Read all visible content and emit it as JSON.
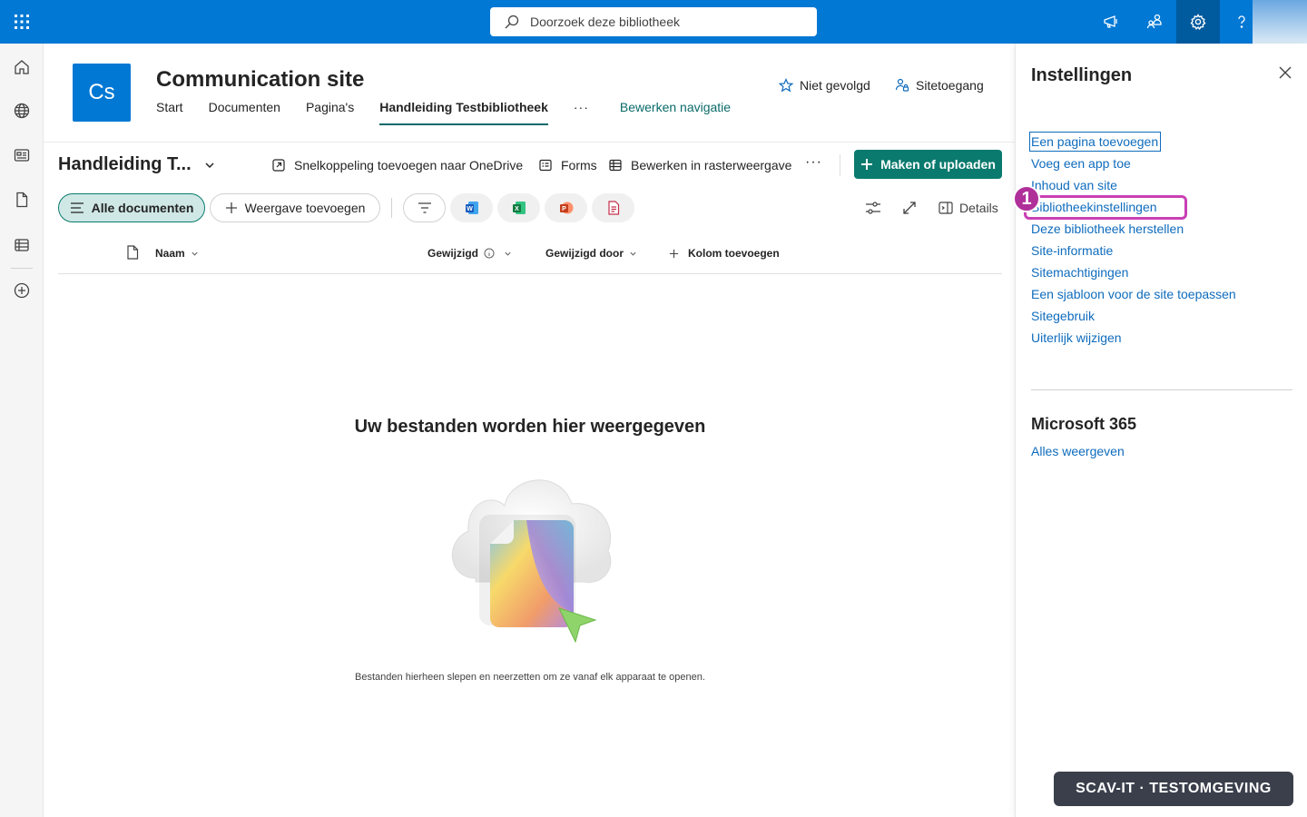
{
  "topbar": {
    "search_placeholder": "Doorzoek deze bibliotheek",
    "icons": [
      "waffle-icon",
      "megaphone-icon",
      "share-people-icon",
      "gear-icon",
      "help-icon"
    ]
  },
  "rail": {
    "items": [
      "home-icon",
      "globe-icon",
      "news-icon",
      "document-icon",
      "list-icon",
      "add-circle-icon"
    ]
  },
  "site": {
    "logo_initials": "Cs",
    "title": "Communication site",
    "nav": [
      {
        "label": "Start"
      },
      {
        "label": "Documenten"
      },
      {
        "label": "Pagina's"
      },
      {
        "label": "Handleiding Testbibliotheek",
        "selected": true
      },
      {
        "label": "···"
      },
      {
        "label": "Bewerken navigatie"
      }
    ],
    "follow_label": "Niet gevolgd",
    "access_label": "Sitetoegang"
  },
  "commandbar": {
    "library_title": "Handleiding T...",
    "shortcut_label": "Snelkoppeling toevoegen naar OneDrive",
    "forms_label": "Forms",
    "grid_label": "Bewerken in rasterweergave",
    "more_label": "···",
    "primary_label": "Maken of uploaden"
  },
  "views": {
    "all_docs_label": "Alle documenten",
    "add_view_label": "Weergave toevoegen",
    "file_filters": [
      "word-icon",
      "excel-icon",
      "powerpoint-icon",
      "pdf-icon"
    ],
    "details_label": "Details"
  },
  "columns": {
    "name": "Naam",
    "modified": "Gewijzigd",
    "modified_by": "Gewijzigd door",
    "add_column": "Kolom toevoegen"
  },
  "empty": {
    "title": "Uw bestanden worden hier weergegeven",
    "subtitle": "Bestanden hierheen slepen en neerzetten om ze vanaf elk apparaat te openen."
  },
  "settings_panel": {
    "title": "Instellingen",
    "links": [
      "Een pagina toevoegen",
      "Voeg een app toe",
      "Inhoud van site",
      "Bibliotheekinstellingen",
      "Deze bibliotheek herstellen",
      "Site-informatie",
      "Sitemachtigingen",
      "Een sjabloon voor de site toepassen",
      "Sitegebruik",
      "Uiterlijk wijzigen"
    ],
    "section_title": "Microsoft 365",
    "section_link": "Alles weergeven",
    "annotation_number": "1"
  },
  "watermark": "SCAV-IT  ·  TESTOMGEVING",
  "colors": {
    "suite_bar": "#0078d4",
    "teal_accent": "#0b7a6e",
    "link_blue": "#0f6cbd",
    "annotation_magenta": "#c940b5"
  }
}
